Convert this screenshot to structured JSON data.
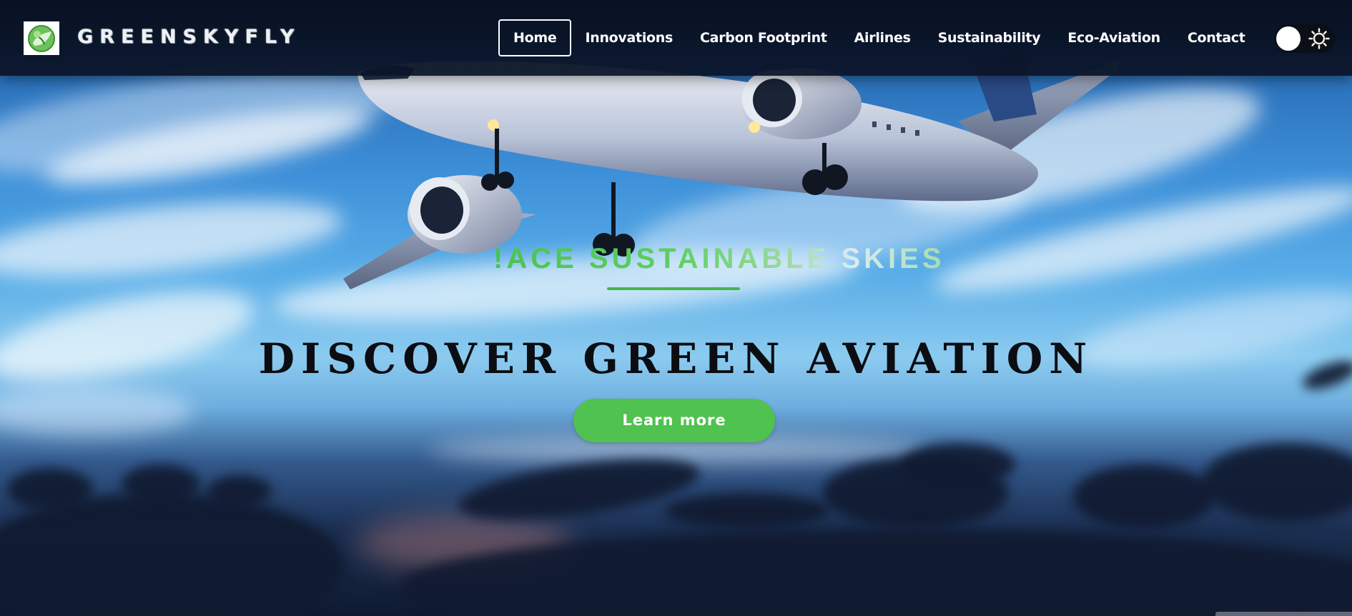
{
  "brand": {
    "name": "GREENSKYFLY",
    "logo_icon": "green-globe-leaf-icon"
  },
  "nav": {
    "items": [
      {
        "label": "Home",
        "active": true
      },
      {
        "label": "Innovations",
        "active": false
      },
      {
        "label": "Carbon Footprint",
        "active": false
      },
      {
        "label": "Airlines",
        "active": false
      },
      {
        "label": "Sustainability",
        "active": false
      },
      {
        "label": "Eco-Aviation",
        "active": false
      },
      {
        "label": "Contact",
        "active": false
      }
    ],
    "theme_toggle": {
      "icon": "sun-icon",
      "state": "light"
    }
  },
  "hero": {
    "subtitle": "!ACE SUSTAINABLE SKIES",
    "title": "DISCOVER GREEN AVIATION",
    "cta_label": "Learn more"
  },
  "colors": {
    "accent_green": "#4fc24f",
    "nav_background": "#0a1428",
    "title_text": "#0b0d12"
  }
}
